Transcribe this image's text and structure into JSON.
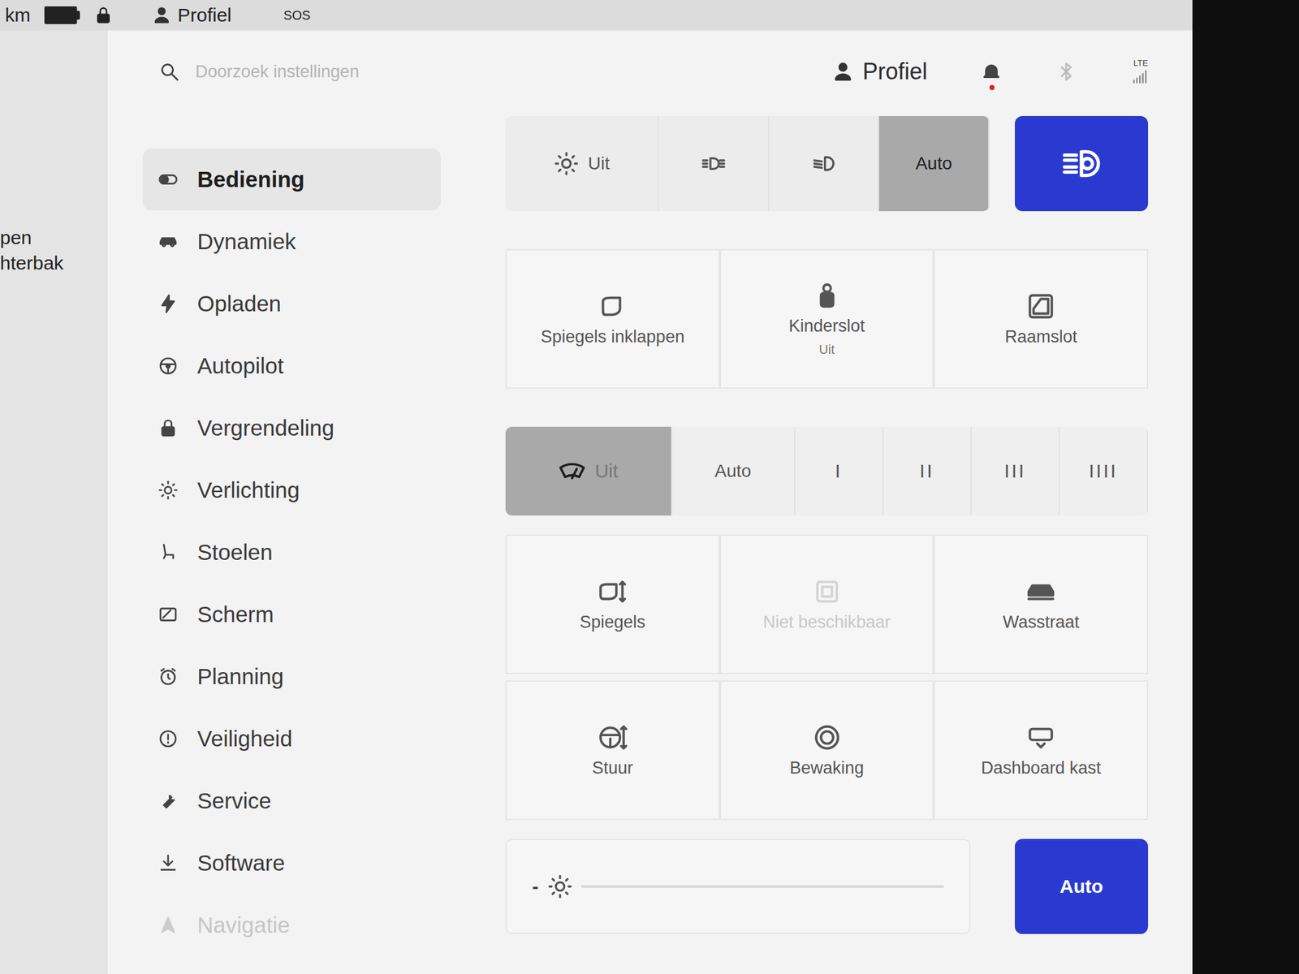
{
  "status_bar": {
    "range": "km",
    "profile": "Profiel",
    "sos": "SOS"
  },
  "left_panel": {
    "texts": [
      "pen",
      "hterbak"
    ]
  },
  "search": {
    "placeholder": "Doorzoek instellingen"
  },
  "header": {
    "profile": "Profiel",
    "notification": true,
    "network": "LTE"
  },
  "sidebar": {
    "items": [
      {
        "label": "Bediening",
        "selected": true,
        "disabled": false
      },
      {
        "label": "Dynamiek",
        "selected": false,
        "disabled": false
      },
      {
        "label": "Opladen",
        "selected": false,
        "disabled": false
      },
      {
        "label": "Autopilot",
        "selected": false,
        "disabled": false
      },
      {
        "label": "Vergrendeling",
        "selected": false,
        "disabled": false
      },
      {
        "label": "Verlichting",
        "selected": false,
        "disabled": false
      },
      {
        "label": "Stoelen",
        "selected": false,
        "disabled": false
      },
      {
        "label": "Scherm",
        "selected": false,
        "disabled": false
      },
      {
        "label": "Planning",
        "selected": false,
        "disabled": false
      },
      {
        "label": "Veiligheid",
        "selected": false,
        "disabled": false
      },
      {
        "label": "Service",
        "selected": false,
        "disabled": false
      },
      {
        "label": "Software",
        "selected": false,
        "disabled": false
      },
      {
        "label": "Navigatie",
        "selected": false,
        "disabled": true
      }
    ]
  },
  "headlights": {
    "options": [
      {
        "kind": "icon-text",
        "label": "Uit",
        "selected": false
      },
      {
        "kind": "icon",
        "selected": false
      },
      {
        "kind": "icon",
        "selected": false
      },
      {
        "kind": "text",
        "label": "Auto",
        "selected": true
      }
    ],
    "auto_high_beam": {
      "on": true
    }
  },
  "controls_row1": [
    {
      "label": "Spiegels inklappen",
      "disabled": false
    },
    {
      "label": "Kinderslot",
      "value": "Uit",
      "disabled": false
    },
    {
      "label": "Raamslot",
      "disabled": false
    }
  ],
  "wipers": {
    "options": [
      {
        "label": "Uit",
        "selected": true
      },
      {
        "label": "Auto",
        "selected": false
      },
      {
        "label": "I",
        "selected": false
      },
      {
        "label": "II",
        "selected": false
      },
      {
        "label": "III",
        "selected": false
      },
      {
        "label": "IIII",
        "selected": false
      }
    ]
  },
  "controls_row2": [
    {
      "label": "Spiegels",
      "disabled": false
    },
    {
      "label": "Niet beschikbaar",
      "disabled": true
    },
    {
      "label": "Wasstraat",
      "disabled": false
    }
  ],
  "controls_row3": [
    {
      "label": "Stuur",
      "disabled": false
    },
    {
      "label": "Bewaking",
      "disabled": false
    },
    {
      "label": "Dashboard kast",
      "disabled": false
    }
  ],
  "brightness": {
    "minus": "-",
    "level": 0,
    "auto": {
      "label": "Auto",
      "selected": true
    }
  }
}
